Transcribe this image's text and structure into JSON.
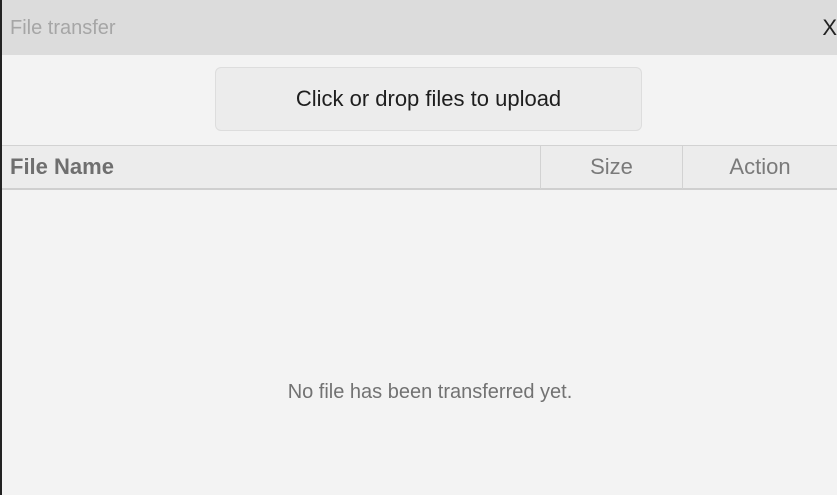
{
  "window": {
    "title": "File transfer",
    "close_label": "X"
  },
  "upload": {
    "label": "Click or drop files to upload"
  },
  "table": {
    "columns": [
      "File Name",
      "Size",
      "Action"
    ],
    "empty_message": "No file has been transferred yet."
  },
  "colors": {
    "titlebar_bg": "#dcdcdc",
    "body_bg": "#f3f3f3",
    "header_bg": "#ececec",
    "button_bg": "#ececec"
  }
}
